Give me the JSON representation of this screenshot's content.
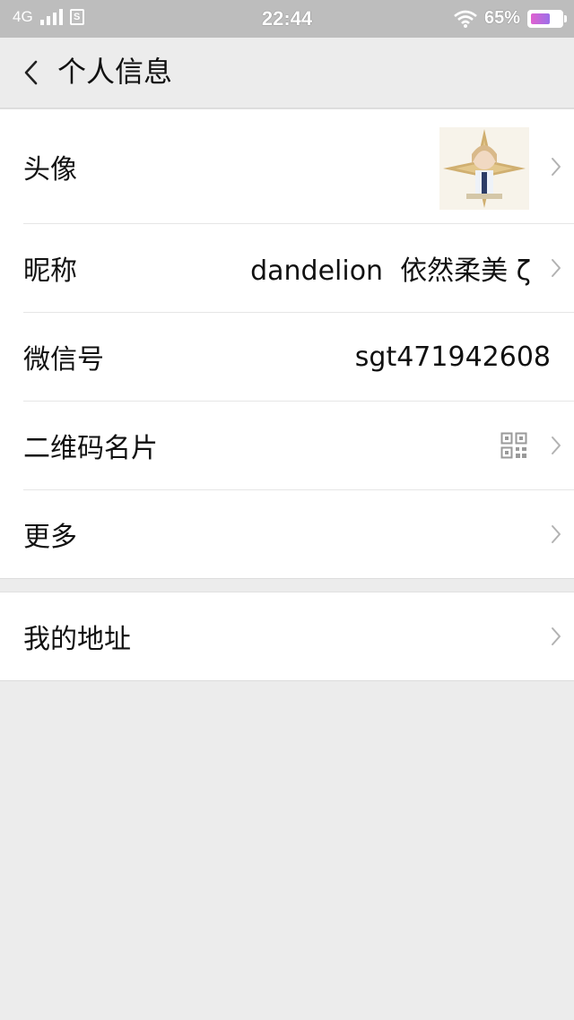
{
  "status_bar": {
    "network": "4G",
    "sim_icon": "sim-card-icon",
    "time": "22:44",
    "battery_text": "65%",
    "battery_level": 0.65,
    "battery_color": "#c46be0"
  },
  "header": {
    "back_icon": "chevron-left-icon",
    "title": "个人信息"
  },
  "rows": {
    "avatar": {
      "label": "头像"
    },
    "nickname": {
      "label": "昵称",
      "value": "dandelion  依然柔美 ζ"
    },
    "wechat_id": {
      "label": "微信号",
      "value": "sgt471942608"
    },
    "qr_card": {
      "label": "二维码名片",
      "icon": "qr-code-icon"
    },
    "more": {
      "label": "更多"
    },
    "address": {
      "label": "我的地址"
    }
  },
  "colors": {
    "page_bg": "#ececec",
    "status_bar_bg": "#bdbdbd",
    "row_bg": "#ffffff",
    "chevron": "#b2b2b2"
  }
}
